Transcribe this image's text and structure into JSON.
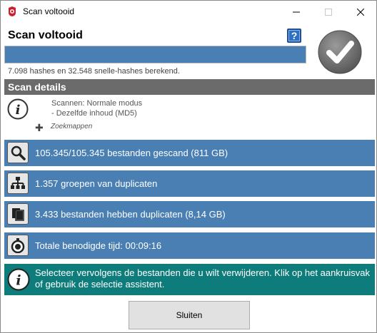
{
  "window": {
    "title": "Scan voltooid"
  },
  "header": {
    "title": "Scan voltooid",
    "help_label": "?",
    "progress_fraction": 1.0,
    "hash_status": "7.098 hashes en 32.548 snelle-hashes berekend."
  },
  "details": {
    "heading": "Scan details",
    "mode_line1": "Scannen: Normale modus",
    "mode_line2": "- Dezelfde inhoud (MD5)",
    "folders_label": "Zoekmappen"
  },
  "rows": [
    {
      "icon": "magnifier-icon",
      "text": "105.345/105.345 bestanden gescand (811 GB)"
    },
    {
      "icon": "group-tree-icon",
      "text": "1.357 groepen van duplicaten"
    },
    {
      "icon": "copies-icon",
      "text": "3.433 bestanden hebben duplicaten (8,14 GB)"
    },
    {
      "icon": "stopwatch-icon",
      "text": "Totale benodigde tijd: 00:09:16"
    }
  ],
  "notice": {
    "text": "Selecteer vervolgens de bestanden die u wilt verwijderen. Klik op het aankruisvak of gebruik de selectie assistent."
  },
  "footer": {
    "close_label": "Sluiten"
  },
  "colors": {
    "row_blue": "#4a7fb3",
    "notice_teal": "#0e7c7b",
    "details_gray": "#6b6b6b"
  }
}
